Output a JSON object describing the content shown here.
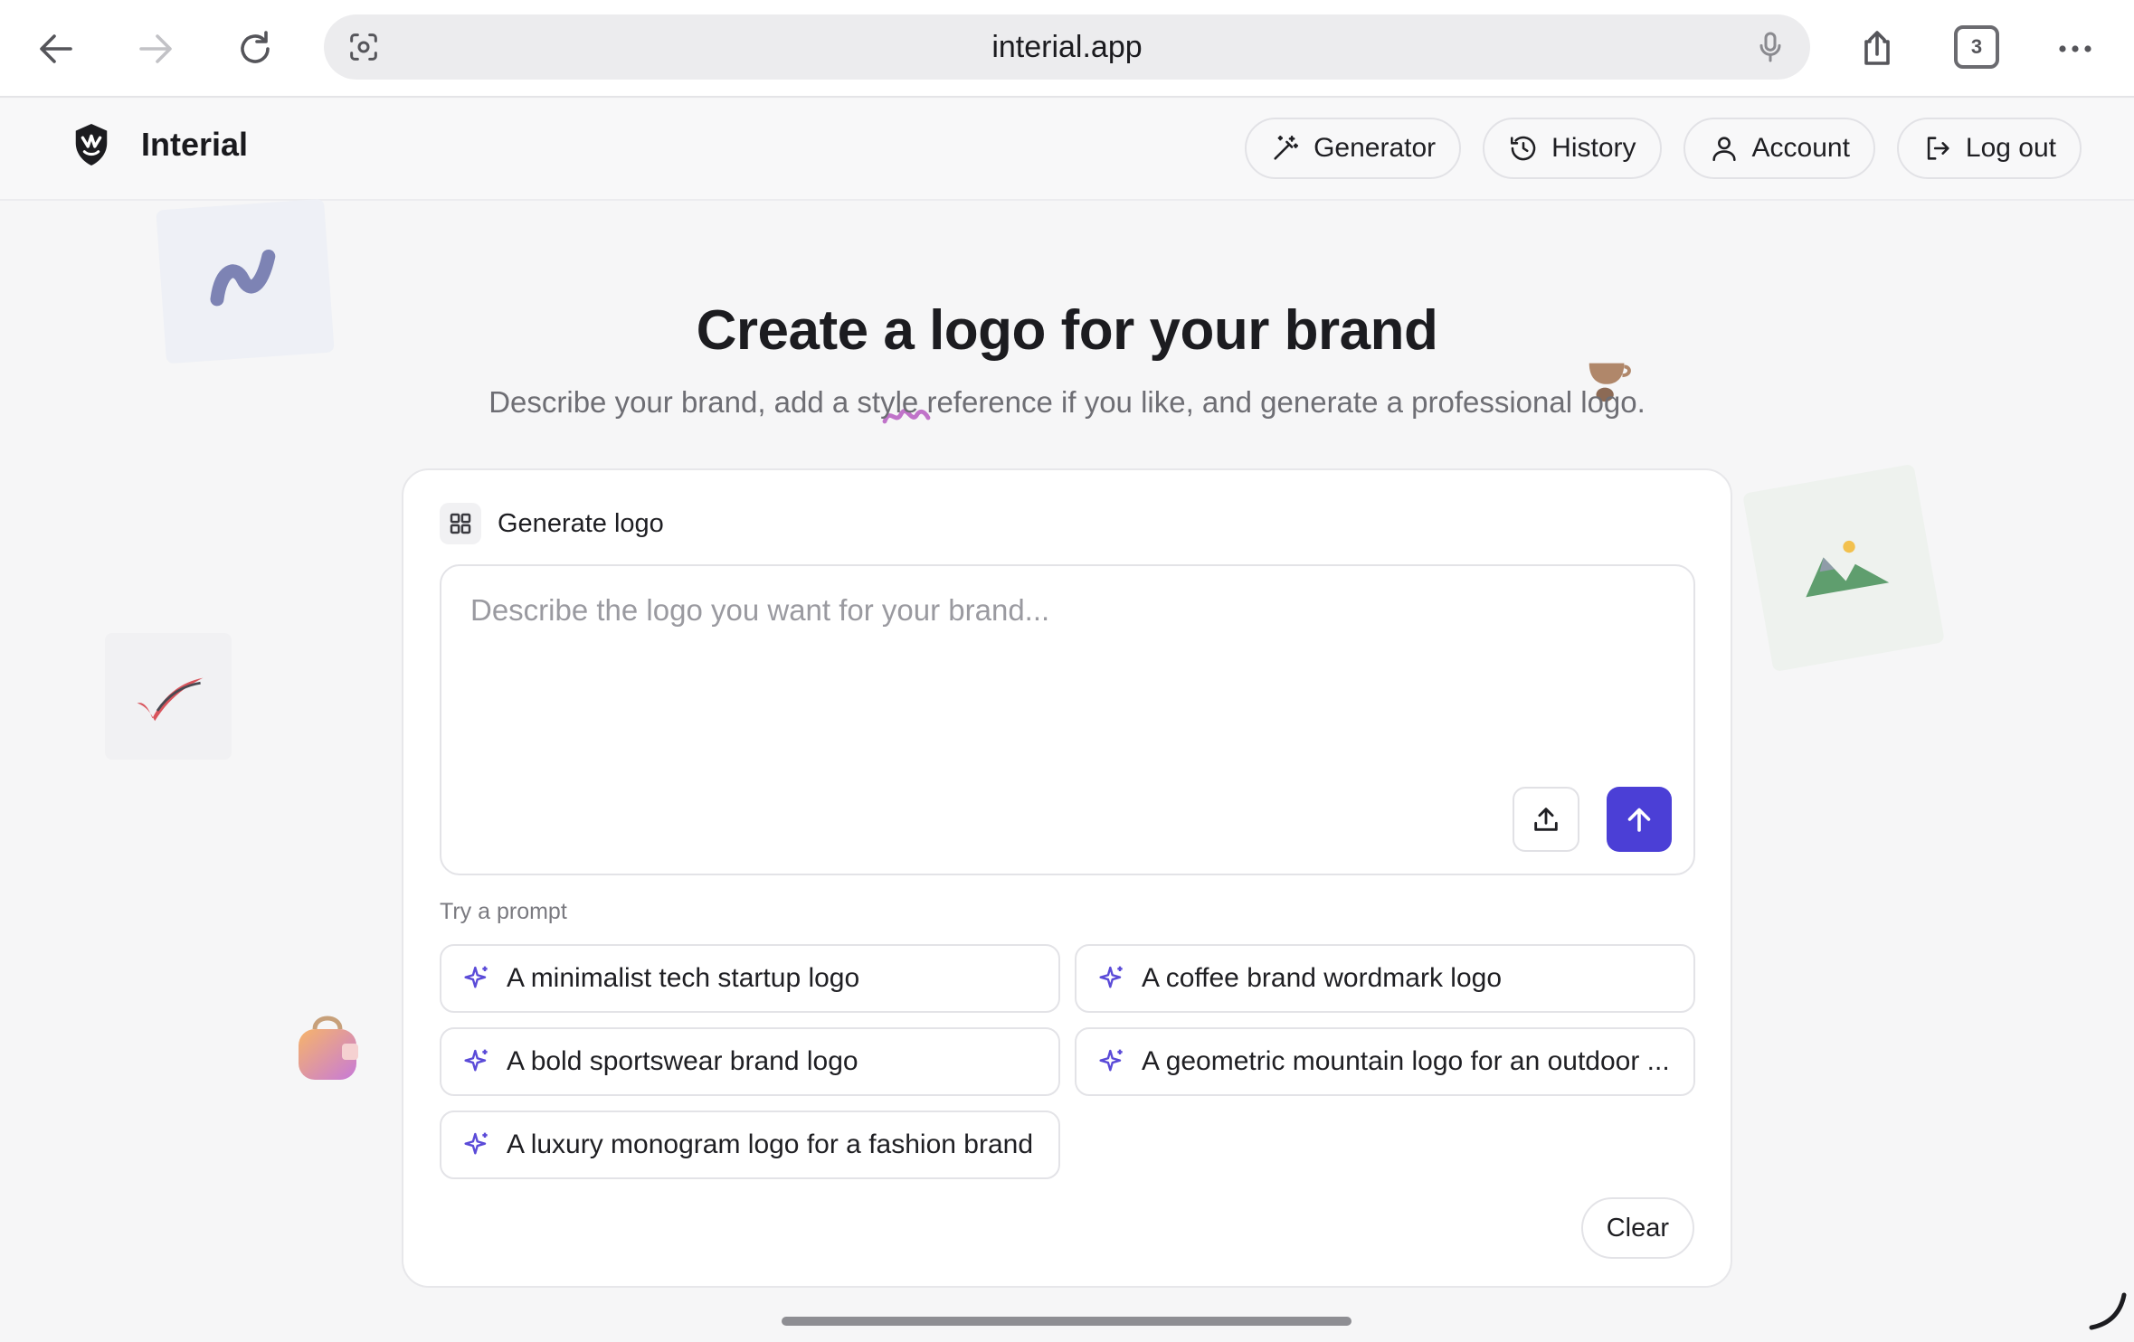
{
  "browser": {
    "url": "interial.app",
    "tab_count": "3",
    "icons": [
      "back-arrow-icon",
      "forward-arrow-icon",
      "reload-icon",
      "screen-capture-icon",
      "microphone-icon",
      "share-icon",
      "tabs-icon",
      "more-icon"
    ]
  },
  "header": {
    "brand_name": "Interial",
    "nav": {
      "generator": "Generator",
      "history": "History",
      "account": "Account",
      "logout": "Log out"
    }
  },
  "hero": {
    "title": "Create a logo for your brand",
    "subtitle": "Describe your brand, add a style reference if you like, and generate a professional logo."
  },
  "card": {
    "title": "Generate logo",
    "prompt_placeholder": "Describe the logo you want for your brand...",
    "try_label": "Try a prompt",
    "suggestions": [
      "A minimalist tech startup logo",
      "A coffee brand wordmark logo",
      "A bold sportswear brand logo",
      "A geometric mountain logo for an outdoor ...",
      "A luxury monogram logo for a fashion brand"
    ],
    "clear_label": "Clear"
  },
  "colors": {
    "accent": "#4b3fd6",
    "sparkle": "#5b4bd8",
    "background": "#f6f6f7"
  }
}
